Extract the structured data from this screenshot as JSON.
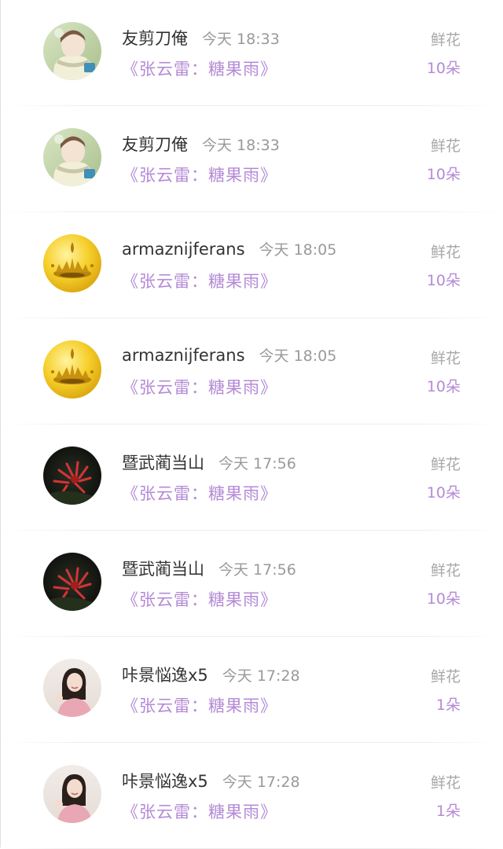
{
  "gift_records": [
    {
      "username": "友剪刀俺",
      "time": "今天 18:33",
      "target": "《张云雷：糖果雨》",
      "gift": "鲜花",
      "count": "10朵",
      "avatar_icon": "avatar-scarf-person-icon"
    },
    {
      "username": "友剪刀俺",
      "time": "今天 18:33",
      "target": "《张云雷：糖果雨》",
      "gift": "鲜花",
      "count": "10朵",
      "avatar_icon": "avatar-scarf-person-icon"
    },
    {
      "username": "armaznijferans",
      "time": "今天 18:05",
      "target": "《张云雷：糖果雨》",
      "gift": "鲜花",
      "count": "10朵",
      "avatar_icon": "avatar-gold-splash-icon"
    },
    {
      "username": "armaznijferans",
      "time": "今天 18:05",
      "target": "《张云雷：糖果雨》",
      "gift": "鲜花",
      "count": "10朵",
      "avatar_icon": "avatar-gold-splash-icon"
    },
    {
      "username": "暨武蔺当山",
      "time": "今天 17:56",
      "target": "《张云雷：糖果雨》",
      "gift": "鲜花",
      "count": "10朵",
      "avatar_icon": "avatar-red-flower-icon"
    },
    {
      "username": "暨武蔺当山",
      "time": "今天 17:56",
      "target": "《张云雷：糖果雨》",
      "gift": "鲜花",
      "count": "10朵",
      "avatar_icon": "avatar-red-flower-icon"
    },
    {
      "username": "咔景悩逸x5",
      "time": "今天 17:28",
      "target": "《张云雷：糖果雨》",
      "gift": "鲜花",
      "count": "1朵",
      "avatar_icon": "avatar-girl-portrait-icon"
    },
    {
      "username": "咔景悩逸x5",
      "time": "今天 17:28",
      "target": "《张云雷：糖果雨》",
      "gift": "鲜花",
      "count": "1朵",
      "avatar_icon": "avatar-girl-portrait-icon"
    }
  ],
  "colors": {
    "accent_purple": "#b48ad6",
    "name_text": "#333333",
    "meta_text": "#999999"
  }
}
